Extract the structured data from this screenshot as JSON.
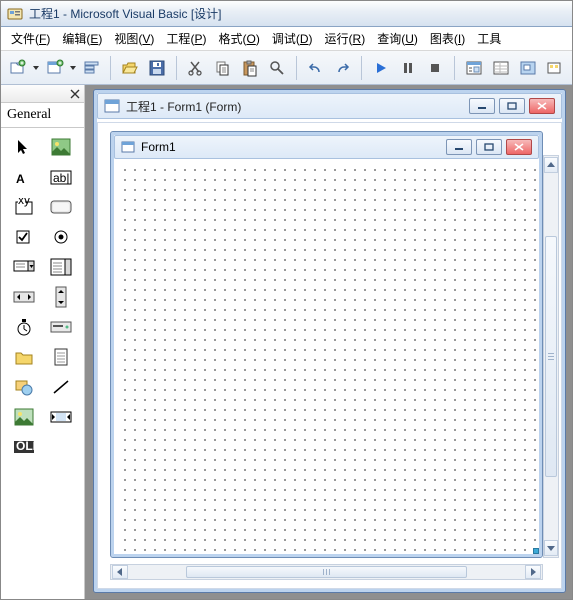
{
  "app": {
    "title": "工程1 - Microsoft Visual Basic [设计]"
  },
  "menu": {
    "items": [
      {
        "label": "文件",
        "key": "F"
      },
      {
        "label": "编辑",
        "key": "E"
      },
      {
        "label": "视图",
        "key": "V"
      },
      {
        "label": "工程",
        "key": "P"
      },
      {
        "label": "格式",
        "key": "O"
      },
      {
        "label": "调试",
        "key": "D"
      },
      {
        "label": "运行",
        "key": "R"
      },
      {
        "label": "查询",
        "key": "U"
      },
      {
        "label": "图表",
        "key": "I"
      },
      {
        "label": "工具",
        "key": ""
      }
    ]
  },
  "toolbar": {
    "buttons": [
      "add-project",
      "add-form",
      "sep",
      "open",
      "save",
      "sep",
      "cut",
      "copy",
      "paste",
      "find",
      "sep",
      "undo",
      "redo",
      "sep",
      "start",
      "break",
      "end",
      "sep",
      "project-explorer",
      "properties",
      "form-layout",
      "object-browser"
    ]
  },
  "toolbox": {
    "title": "General",
    "tools": [
      "pointer",
      "picturebox",
      "label",
      "textbox",
      "frame",
      "commandbutton",
      "checkbox",
      "optionbutton",
      "combobox",
      "listbox",
      "hscrollbar",
      "vscrollbar",
      "timer",
      "drivelistbox",
      "dirlistbox",
      "filelistbox",
      "shape",
      "line",
      "image",
      "data",
      "ole"
    ]
  },
  "designer": {
    "window_title": "工程1 - Form1 (Form)",
    "form_title": "Form1"
  }
}
